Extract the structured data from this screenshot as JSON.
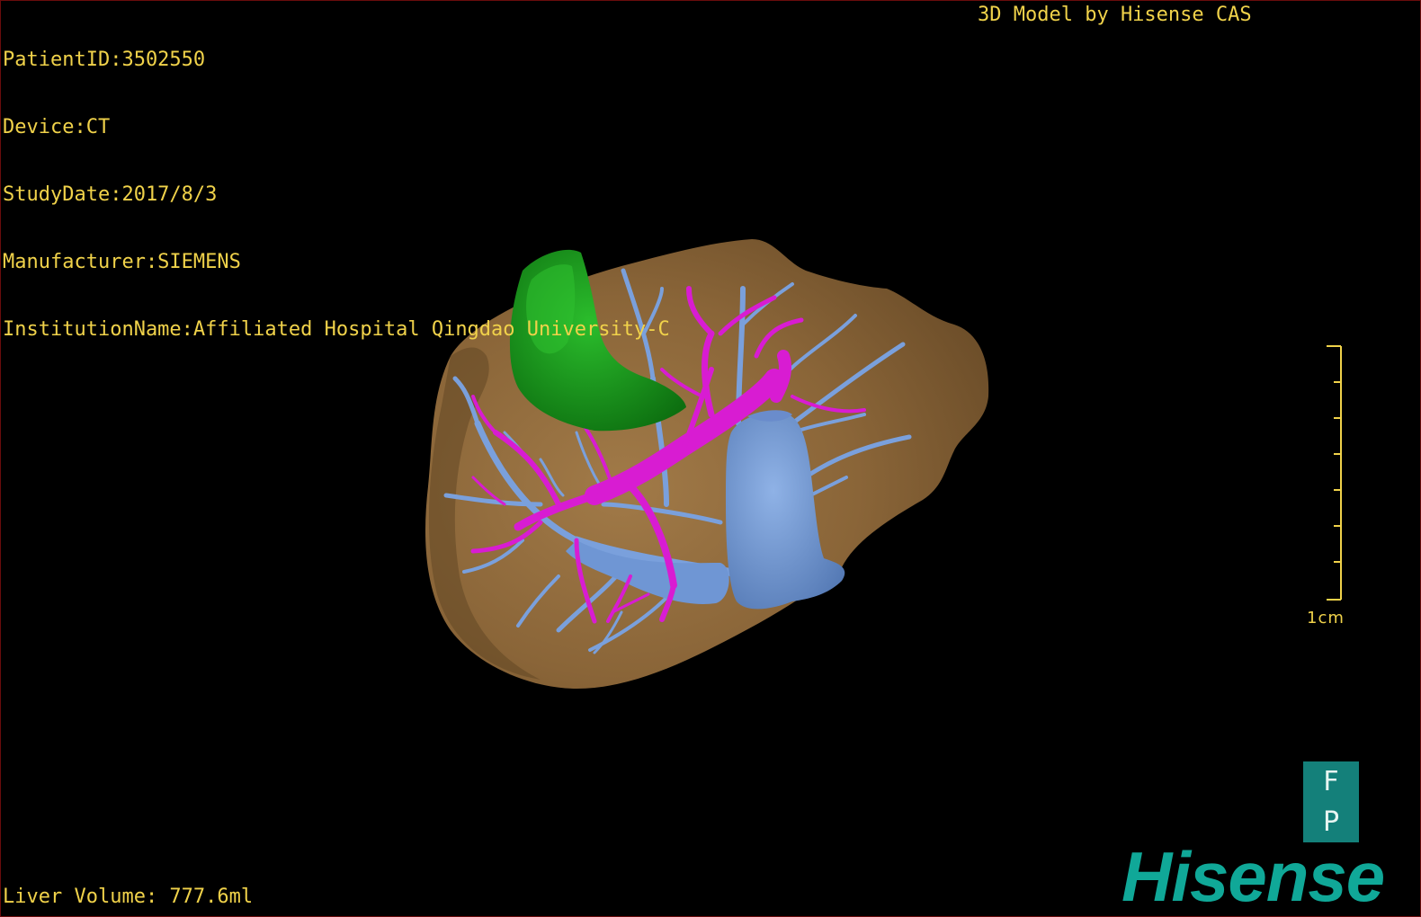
{
  "dicom_info": {
    "patient_id": "PatientID:3502550",
    "device": "Device:CT",
    "study_date": "StudyDate:2017/8/3",
    "manufacturer": "Manufacturer:SIEMENS",
    "institution": "InstitutionName:Affiliated Hospital Qingdao University-C"
  },
  "brand_credit": "3D Model by Hisense CAS",
  "liver_volume": "Liver Volume: 777.6ml",
  "scale_bar": {
    "label": "1cm"
  },
  "orientation_cube": {
    "top_face": "F",
    "front_face": "P"
  },
  "brand_logo": "Hisense",
  "colors": {
    "overlay_text": "#f0d24a",
    "liver": "#8a6538",
    "gallbladder": "#139117",
    "portal_vein": "#d81cd2",
    "hepatic_vein": "#7aa0dc",
    "logo": "#10a898"
  }
}
